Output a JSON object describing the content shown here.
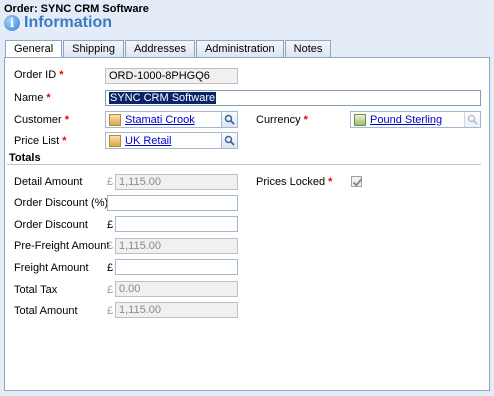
{
  "header": {
    "title": "Order: SYNC CRM Software",
    "heading": "Information"
  },
  "tabs": [
    "General",
    "Shipping",
    "Addresses",
    "Administration",
    "Notes"
  ],
  "general": {
    "order_id": {
      "label": "Order ID",
      "value": "ORD-1000-8PHGQ6"
    },
    "name": {
      "label": "Name",
      "value": "SYNC CRM Software"
    },
    "customer": {
      "label": "Customer",
      "value": "Stamati Crook"
    },
    "price_list": {
      "label": "Price List",
      "value": "UK Retail"
    },
    "currency": {
      "label": "Currency",
      "value": "Pound Sterling"
    }
  },
  "totals": {
    "heading": "Totals",
    "currency_symbol": "£",
    "detail_amount": {
      "label": "Detail Amount",
      "value": "1,115.00"
    },
    "order_discount_pct": {
      "label": "Order Discount (%)",
      "value": ""
    },
    "order_discount": {
      "label": "Order Discount",
      "value": ""
    },
    "pre_freight_amount": {
      "label": "Pre-Freight Amount",
      "value": "1,115.00"
    },
    "freight_amount": {
      "label": "Freight Amount",
      "value": ""
    },
    "total_tax": {
      "label": "Total Tax",
      "value": "0.00"
    },
    "total_amount": {
      "label": "Total Amount",
      "value": "1,115.00"
    },
    "prices_locked": {
      "label": "Prices Locked",
      "checked": true
    }
  },
  "required_marker": "*",
  "icons": {
    "lookup": "lookup-magnifier-icon",
    "customer": "contact-card-icon",
    "currency": "currency-icon",
    "info": "info-icon"
  },
  "colors": {
    "background": "#e3ecf7",
    "heading": "#3a7cc4",
    "required": "#e00000",
    "link": "#0000cc"
  }
}
